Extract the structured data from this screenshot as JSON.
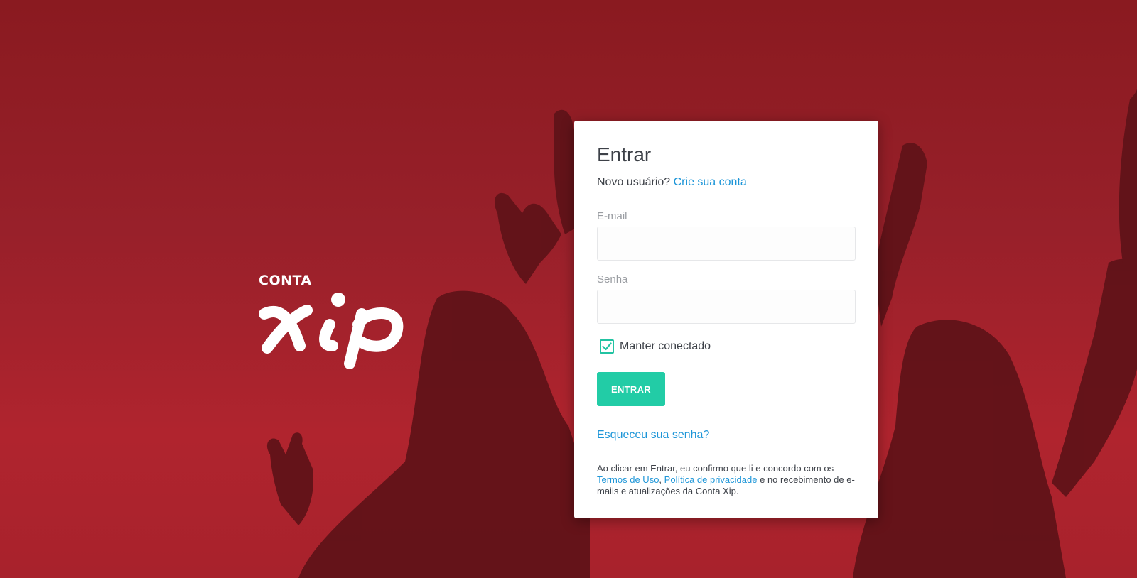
{
  "brand": {
    "small_label": "CONTA",
    "logo_text": "xip"
  },
  "login": {
    "title": "Entrar",
    "new_user_prompt": "Novo usuário?",
    "create_account_link": "Crie sua conta",
    "email_label": "E-mail",
    "email_value": "",
    "email_placeholder": "",
    "password_label": "Senha",
    "password_value": "",
    "password_placeholder": "",
    "remember_label": "Manter conectado",
    "remember_checked": true,
    "submit_label": "ENTRAR",
    "forgot_link": "Esqueceu sua senha?",
    "legal": {
      "prefix": "Ao clicar em Entrar, eu confirmo que li e concordo com os",
      "terms_link": "Termos de Uso",
      "separator": ",",
      "privacy_link": "Política de privacidade",
      "suffix": "e no recebimento de e-mails e atualizações da Conta Xip."
    }
  },
  "colors": {
    "background": "#98202a",
    "accent": "#22cca6",
    "link": "#1e96d8",
    "text": "#3d4148",
    "muted": "#9a9da2"
  },
  "icons": {
    "checkbox": "check-icon"
  }
}
